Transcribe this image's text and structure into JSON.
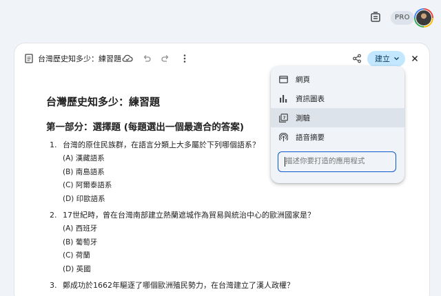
{
  "topbar": {
    "pro_label": "PRO",
    "icons": [
      "document-gear-icon",
      "avatar"
    ]
  },
  "doc": {
    "title": "台灣歷史知多少：練習題",
    "create_label": "建立",
    "heading": "台灣歷史知多少：練習題",
    "section_title": "第一部分：選擇題 (每題選出一個最適合的答案)",
    "questions": [
      {
        "num": "1.",
        "text": "台灣的原住民族群，在語言分類上大多屬於下列哪個語系？",
        "options": [
          "(A) 漢藏語系",
          "(B) 南島語系",
          "(C) 阿爾泰語系",
          "(D) 印歐語系"
        ]
      },
      {
        "num": "2.",
        "text": "17世紀時，曾在台灣南部建立熱蘭遮城作為貿易與統治中心的歐洲國家是？",
        "options": [
          "(A) 西班牙",
          "(B) 葡萄牙",
          "(C) 荷蘭",
          "(D) 英國"
        ]
      },
      {
        "num": "3.",
        "text": "鄭成功於1662年驅逐了哪個歐洲殖民勢力，在台灣建立了漢人政權？",
        "options": []
      }
    ]
  },
  "create_menu": {
    "items": [
      {
        "label": "網頁",
        "icon": "webpage-icon"
      },
      {
        "label": "資訊圖表",
        "icon": "bar-chart-icon"
      },
      {
        "label": "測驗",
        "icon": "quiz-icon",
        "selected": true
      },
      {
        "label": "語音摘要",
        "icon": "podcast-icon"
      }
    ],
    "input_placeholder": "描述你要打造的應用程式"
  },
  "colors": {
    "background": "#f0f4f9",
    "create_button": "#c2e7ff",
    "input_border": "#0b57d0",
    "selected_item": "#dde3ea"
  }
}
